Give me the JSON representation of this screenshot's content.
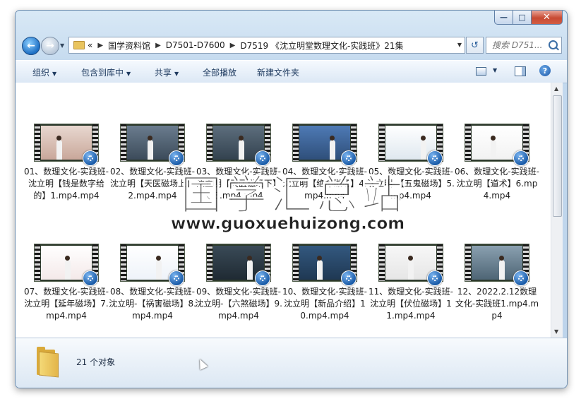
{
  "address": {
    "history_glyph": "«",
    "crumbs": [
      "国学资料馆",
      "D7501-D7600",
      "D7519 《沈立明堂数理文化-实践班》21集"
    ]
  },
  "search": {
    "placeholder": "搜索 D751..."
  },
  "toolbar": {
    "organize": "组织",
    "include_library": "包含到库中",
    "share": "共享",
    "play_all": "全部播放",
    "new_folder": "新建文件夹"
  },
  "files": [
    {
      "label": "01、数理文化-实践班-沈立明【钱是数字给的】1.mp4.mp4"
    },
    {
      "label": "02、数理文化-实践班-沈立明【天医磁场上】2.mp4.mp4"
    },
    {
      "label": "03、数理文化-实践班-沈立明【天医磁场下】3.mp4.mp4"
    },
    {
      "label": "04、数理文化-实践班-沈立明【绝命磁场】4.mp4.mp4"
    },
    {
      "label": "05、数理文化-实践班-沈立明-【五鬼磁场】5.mp4.mp4"
    },
    {
      "label": "06、数理文化-实践班-沈立明【道术】6.mp4.mp4"
    },
    {
      "label": "07、数理文化-实践班-沈立明【延年磁场】7.mp4.mp4"
    },
    {
      "label": "08、数理文化-实践班-沈立明-【祸害磁场】8.mp4.mp4"
    },
    {
      "label": "09、数理文化-实践班-沈立明-【六煞磁场】9.mp4.mp4"
    },
    {
      "label": "10、数理文化-实践班-沈立明【新品介绍】10.mp4.mp4"
    },
    {
      "label": "11、数理文化-实践班-沈立明【伏位磁场】11.mp4.mp4"
    },
    {
      "label": "12、2022.2.12数理文化-实践班1.mp4.mp4"
    }
  ],
  "status": {
    "count": "21 个对象"
  },
  "watermark": {
    "cn": "国学汇总站",
    "url": "www.guoxuehuizong.com"
  },
  "colors": {
    "accent": "#1b5ca8",
    "toolbar_text": "#1e3a5f",
    "folder": "#e3b54a"
  }
}
